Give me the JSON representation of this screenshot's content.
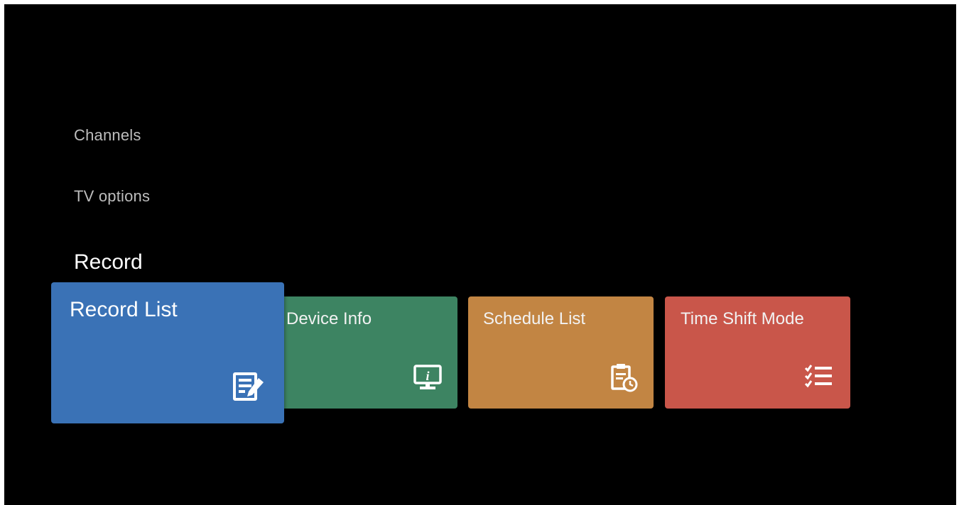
{
  "menu": {
    "items": [
      {
        "label": "Channels"
      },
      {
        "label": "TV options"
      },
      {
        "label": "Record"
      }
    ]
  },
  "tiles": [
    {
      "label": "Record List",
      "color": "#3a72b6",
      "icon": "edit-list-icon"
    },
    {
      "label": "Device Info",
      "color": "#3d8462",
      "icon": "monitor-info-icon"
    },
    {
      "label": "Schedule List",
      "color": "#c28543",
      "icon": "clipboard-clock-icon"
    },
    {
      "label": "Time Shift Mode",
      "color": "#c9564a",
      "icon": "checklist-icon"
    }
  ]
}
